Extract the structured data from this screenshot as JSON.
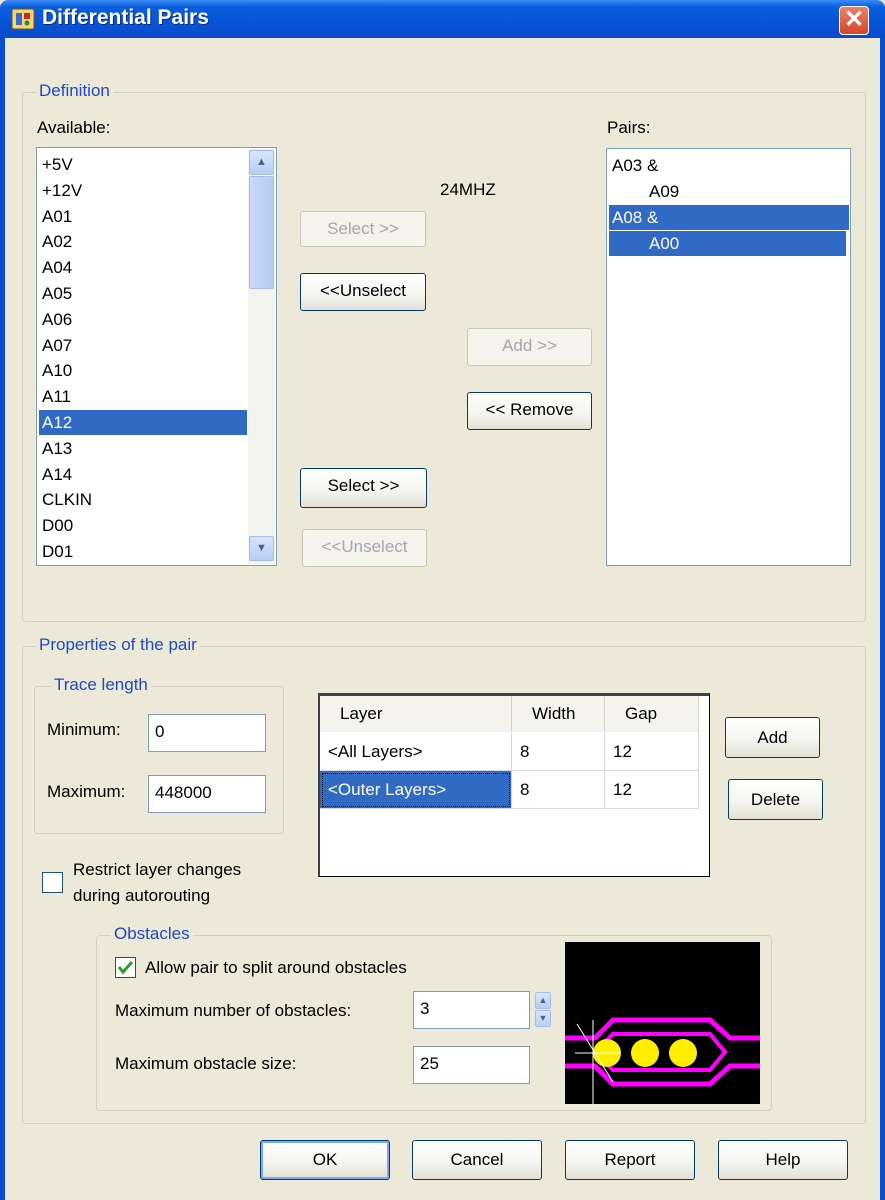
{
  "window": {
    "title": "Differential Pairs",
    "close_glyph": "✕",
    "app_icon": "pcb-app-icon"
  },
  "definition": {
    "legend": "Definition",
    "available_label": "Available:",
    "pairs_label": "Pairs:",
    "available_items": [
      "+5V",
      "+12V",
      "A01",
      "A02",
      "A04",
      "A05",
      "A06",
      "A07",
      "A10",
      "A11",
      "A12",
      "A13",
      "A14",
      "CLKIN",
      "D00",
      "D01"
    ],
    "available_selected": "A12",
    "net_name": "24MHZ",
    "select_top": "Select >>",
    "unselect_top": "<<Unselect",
    "add": "Add >>",
    "remove": "<< Remove",
    "select_bottom": "Select >>",
    "unselect_bottom": "<<Unselect",
    "pairs": [
      {
        "first": "A03 &",
        "second": "A09",
        "selected": false
      },
      {
        "first": "A08 &",
        "second": "A00",
        "selected": true
      }
    ]
  },
  "properties": {
    "legend": "Properties of the pair",
    "trace_length": {
      "legend": "Trace length",
      "minimum_label": "Minimum:",
      "minimum_value": "0",
      "maximum_label": "Maximum:",
      "maximum_value": "448000"
    },
    "layer_table": {
      "headers": [
        "Layer",
        "Width",
        "Gap"
      ],
      "rows": [
        {
          "layer": "<All Layers>",
          "width": "8",
          "gap": "12"
        },
        {
          "layer": "<Outer Layers>",
          "width": "8",
          "gap": "12"
        }
      ]
    },
    "add_button": "Add",
    "delete_button": "Delete",
    "restrict_line1": "Restrict layer changes",
    "restrict_line2": "during autorouting",
    "restrict_checked": false,
    "obstacles": {
      "legend": "Obstacles",
      "allow_split_label": "Allow pair to split around obstacles",
      "allow_split_checked": true,
      "max_number_label": "Maximum number of obstacles:",
      "max_number_value": "3",
      "max_size_label": "Maximum obstacle size:",
      "max_size_value": "25"
    }
  },
  "footer": {
    "ok": "OK",
    "cancel": "Cancel",
    "report": "Report",
    "help": "Help"
  },
  "colors": {
    "selection": "#316ac5",
    "legend_text": "#1c49c8",
    "trace_pink": "#ff00ff",
    "via_yellow": "#ffee00"
  }
}
